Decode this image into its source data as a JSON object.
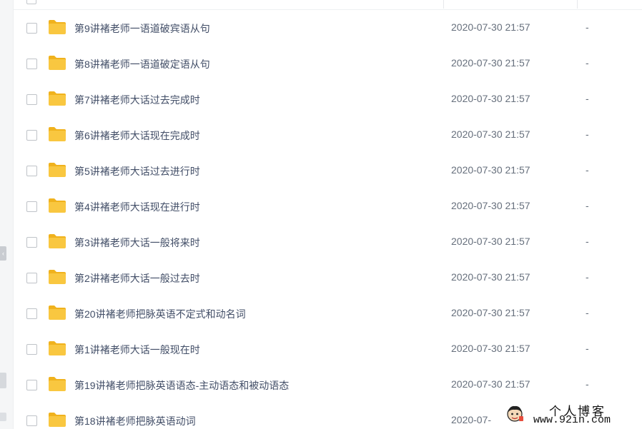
{
  "colors": {
    "folder": "#f9c740",
    "folder_tab": "#f0b21d",
    "name_text": "#424e67",
    "meta_text": "#666f7c"
  },
  "icons": {
    "folder": "folder-icon",
    "checkbox": "checkbox-icon"
  },
  "files": [
    {
      "name": "第9讲褚老师一语道破宾语从句",
      "time": "2020-07-30 21:57",
      "size": "-"
    },
    {
      "name": "第8讲褚老师一语道破定语从句",
      "time": "2020-07-30 21:57",
      "size": "-"
    },
    {
      "name": "第7讲褚老师大话过去完成时",
      "time": "2020-07-30 21:57",
      "size": "-"
    },
    {
      "name": "第6讲褚老师大话现在完成时",
      "time": "2020-07-30 21:57",
      "size": "-"
    },
    {
      "name": "第5讲褚老师大话过去进行时",
      "time": "2020-07-30 21:57",
      "size": "-"
    },
    {
      "name": "第4讲褚老师大话现在进行时",
      "time": "2020-07-30 21:57",
      "size": "-"
    },
    {
      "name": "第3讲褚老师大话一般将来时",
      "time": "2020-07-30 21:57",
      "size": "-"
    },
    {
      "name": "第2讲褚老师大话一般过去时",
      "time": "2020-07-30 21:57",
      "size": "-"
    },
    {
      "name": "第20讲褚老师把脉英语不定式和动名词",
      "time": "2020-07-30 21:57",
      "size": "-"
    },
    {
      "name": "第1讲褚老师大话一般现在时",
      "time": "2020-07-30 21:57",
      "size": "-"
    },
    {
      "name": "第19讲褚老师把脉英语语态-主动语态和被动语态",
      "time": "2020-07-30 21:57",
      "size": "-"
    },
    {
      "name": "第18讲褚老师把脉英语动词",
      "time": "2020-07-",
      "size": ""
    }
  ],
  "watermark": {
    "title": "个人博客",
    "url": "www.92in.com"
  }
}
